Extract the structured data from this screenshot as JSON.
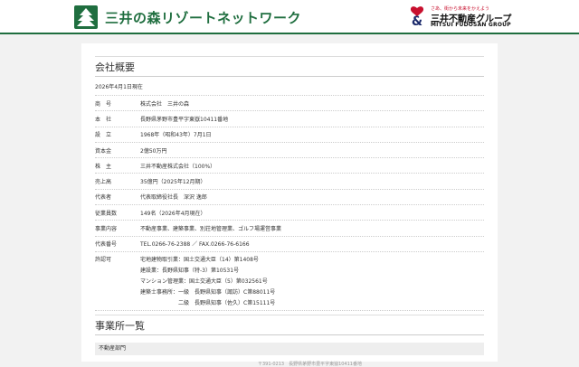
{
  "header": {
    "brand": "三井の森リゾートネットワーク",
    "mf_tagline": "さあ、街から未来をかえよう",
    "mf_name_ja": "三井不動産グループ",
    "mf_name_en": "MITSUI FUDOSAN GROUP",
    "colors": {
      "green": "#1f6e3f",
      "red": "#c8102e",
      "navy": "#1b2a6b"
    }
  },
  "company": {
    "title": "会社概要",
    "as_of": "2026年4月1日現在",
    "rows": [
      {
        "label": "商　号",
        "value": "株式会社　三井の森"
      },
      {
        "label": "本　社",
        "value": "長野県茅野市豊平字東嶽10411番地"
      },
      {
        "label": "設　立",
        "value": "1968年（昭和43年）7月1日"
      },
      {
        "label": "資本金",
        "value": "2億50万円"
      },
      {
        "label": "株　主",
        "value": "三井不動産株式会社（100%）"
      },
      {
        "label": "売上高",
        "value": "35億円（2025年12月期）"
      },
      {
        "label": "代表者",
        "value": "代表取締役社長　深沢 逸郎"
      },
      {
        "label": "従業員数",
        "value": "149名（2026年4月現在）"
      },
      {
        "label": "事業内容",
        "value": "不動産事業、建築事業、別荘地管理業、ゴルフ場運営事業"
      },
      {
        "label": "代表番号",
        "value": "TEL.0266-76-2388 ／ FAX.0266-76-6166"
      }
    ],
    "license": {
      "label": "許認可",
      "lines": [
        "宅地建物取引業：国土交通大臣（14）第1408号",
        "建設業：長野県知事（特-3）第10531号",
        "マンション管理業：国土交通大臣（5）第032561号",
        "建築士事務所：一級　長野県知事（諏訪）C第88011号",
        "　　　　　　　二級　長野県知事（佐久）C第15111号"
      ]
    }
  },
  "offices": {
    "title": "事業所一覧",
    "dept": "不動産部門",
    "peek": "〒391-0213　長野県茅野市豊平字東嶽10411番地"
  }
}
